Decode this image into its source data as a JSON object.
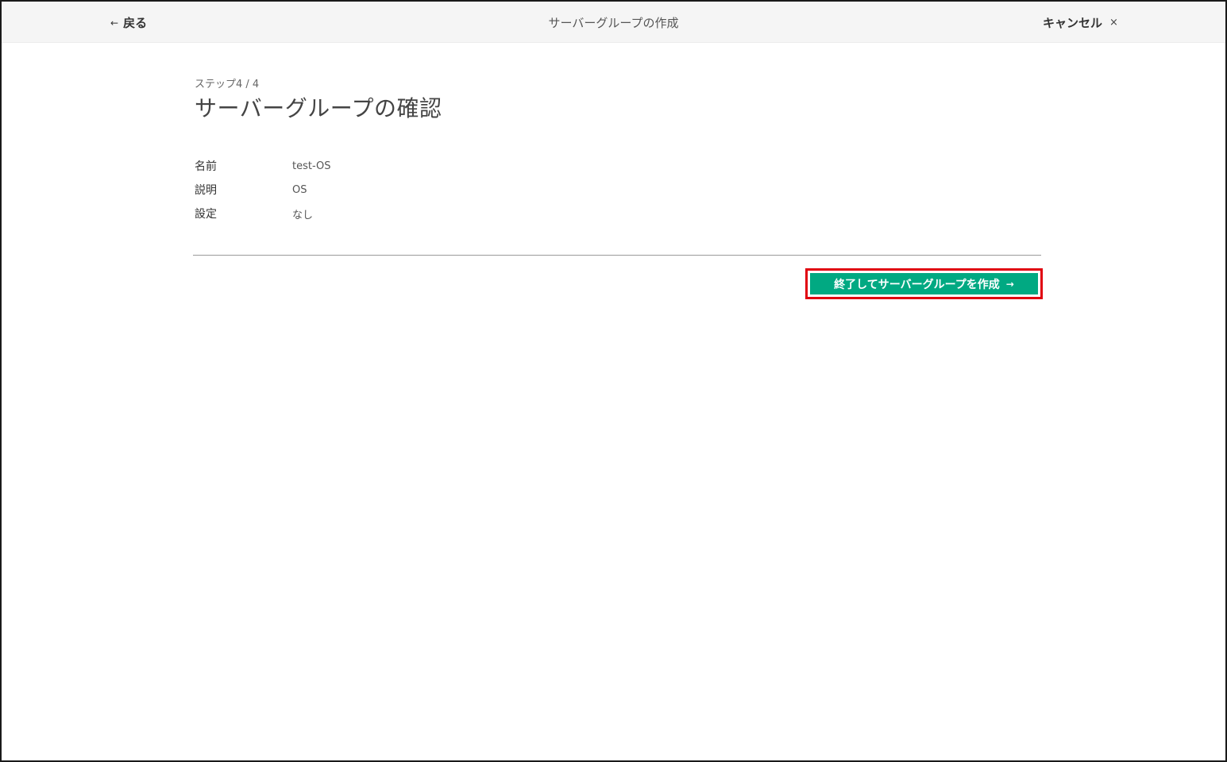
{
  "header": {
    "back_label": "戻る",
    "back_icon": "arrow-left-icon",
    "title": "サーバーグループの作成",
    "cancel_label": "キャンセル",
    "cancel_icon": "close-icon"
  },
  "wizard": {
    "step_label": "ステップ4 / 4",
    "page_title": "サーバーグループの確認"
  },
  "summary": {
    "rows": [
      {
        "key": "名前",
        "value": "test-OS"
      },
      {
        "key": "説明",
        "value": "OS"
      },
      {
        "key": "設定",
        "value": "なし"
      }
    ]
  },
  "footer": {
    "finish_label": "終了してサーバーグループを作成",
    "finish_icon": "arrow-right-icon"
  },
  "colors": {
    "primary": "#01a982",
    "highlight": "#e0000f",
    "header_bg": "#f5f5f5"
  }
}
